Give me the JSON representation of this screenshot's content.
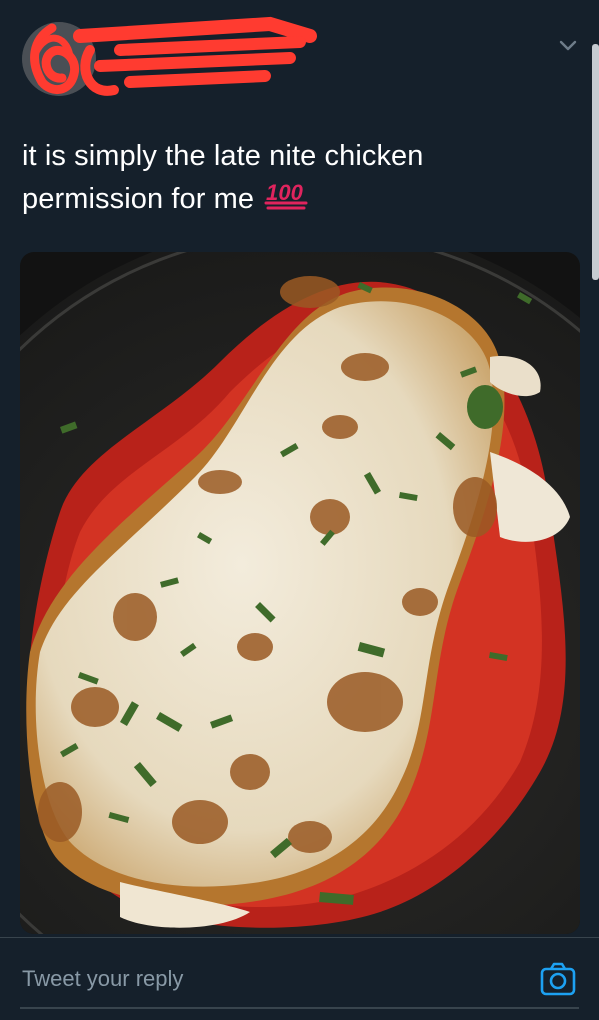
{
  "tweet": {
    "text": "it is simply the late nite chicken permission for me",
    "emoji_icon": "hundred-points-icon"
  },
  "header": {
    "menu_icon": "chevron-down-icon",
    "avatar_redacted": true
  },
  "media": {
    "description_icon": "tweet-photo"
  },
  "reply": {
    "placeholder": "Tweet your reply",
    "camera_icon": "camera-icon"
  },
  "colors": {
    "background": "#15202b",
    "accent": "#1da1f2",
    "text_secondary": "#8899a6",
    "redaction": "#ff3b30"
  }
}
